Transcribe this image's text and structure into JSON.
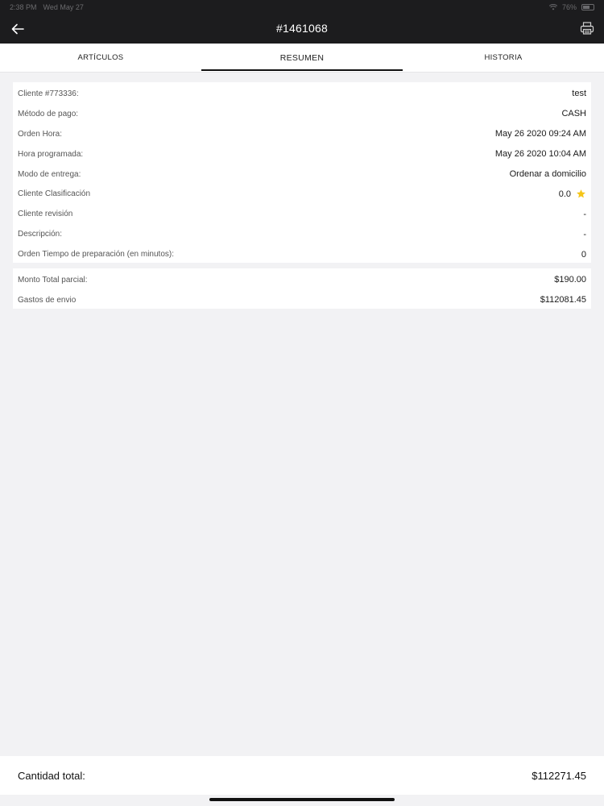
{
  "status_bar": {
    "time": "2:38 PM",
    "date": "Wed May 27",
    "battery": "76%"
  },
  "header": {
    "title": "#1461068"
  },
  "tabs": [
    {
      "label": "ARTÍCULOS",
      "active": false
    },
    {
      "label": "RESUMEN",
      "active": true
    },
    {
      "label": "HISTORIA",
      "active": false
    }
  ],
  "details": [
    {
      "label": "Cliente #773336:",
      "value": "test"
    },
    {
      "label": "Método de pago:",
      "value": "CASH"
    },
    {
      "label": "Orden Hora:",
      "value": "May 26 2020 09:24 AM"
    },
    {
      "label": "Hora programada:",
      "value": "May 26 2020 10:04 AM"
    },
    {
      "label": "Modo de entrega:",
      "value": "Ordenar a domicilio"
    },
    {
      "label": "Cliente Clasificación",
      "value": "0.0",
      "icon": "star-icon"
    },
    {
      "label": "Cliente revisión",
      "value": "-"
    },
    {
      "label": "Descripción:",
      "value": "-"
    },
    {
      "label": "Orden Tiempo de preparación (en minutos):",
      "value": "0"
    }
  ],
  "amounts": [
    {
      "label": "Monto Total parcial:",
      "value": "$190.00"
    },
    {
      "label": "Gastos de envio",
      "value": "$112081.45"
    }
  ],
  "footer": {
    "label": "Cantidad total:",
    "value": "$112271.45"
  },
  "colors": {
    "header_bg": "#1c1c1e",
    "star": "#f5c518",
    "page_bg": "#f2f2f4"
  }
}
